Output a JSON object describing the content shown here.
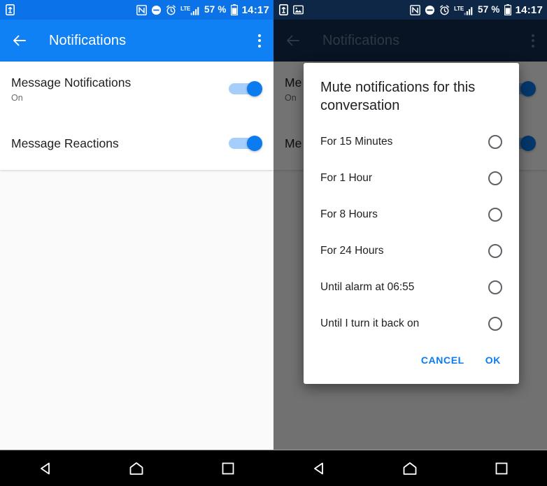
{
  "screens": {
    "left": {
      "statusbar": {
        "left_icons": [
          "sd-card-transfer-icon"
        ],
        "nfc_icon": "nfc-icon",
        "dnd_icon": "do-not-disturb-icon",
        "alarm_icon": "alarm-icon",
        "network_label": "LTE",
        "signal_icon": "signal-bars-icon",
        "battery_percent": "57 %",
        "battery_icon": "battery-icon",
        "time": "14:17"
      },
      "appbar": {
        "back_icon": "back-arrow-icon",
        "title": "Notifications",
        "overflow_icon": "overflow-menu-icon"
      },
      "settings": [
        {
          "title": "Message Notifications",
          "subtitle": "On",
          "switch_state": "on"
        },
        {
          "title": "Message Reactions",
          "subtitle": "",
          "switch_state": "on"
        }
      ]
    },
    "right": {
      "statusbar": {
        "left_icons": [
          "sd-card-transfer-icon",
          "image-icon"
        ],
        "nfc_icon": "nfc-icon",
        "dnd_icon": "do-not-disturb-icon",
        "alarm_icon": "alarm-icon",
        "network_label": "LTE",
        "signal_icon": "signal-bars-icon",
        "battery_percent": "57 %",
        "battery_icon": "battery-icon",
        "time": "14:17"
      },
      "appbar": {
        "back_icon": "back-arrow-icon",
        "title": "Notifications",
        "overflow_icon": "overflow-menu-icon"
      },
      "settings": [
        {
          "title": "Me",
          "subtitle": "On",
          "switch_state": "on"
        },
        {
          "title": "Me",
          "subtitle": "",
          "switch_state": "on"
        }
      ],
      "dialog": {
        "title": "Mute notifications for this conversation",
        "options": [
          {
            "label": "For 15 Minutes",
            "selected": false
          },
          {
            "label": "For 1 Hour",
            "selected": false
          },
          {
            "label": "For 8 Hours",
            "selected": false
          },
          {
            "label": "For 24 Hours",
            "selected": false
          },
          {
            "label": "Until alarm at 06:55",
            "selected": false
          },
          {
            "label": "Until I turn it back on",
            "selected": false
          }
        ],
        "cancel_label": "CANCEL",
        "ok_label": "OK"
      }
    }
  },
  "navbar": {
    "back_icon": "nav-back-triangle-icon",
    "home_icon": "nav-home-icon",
    "recents_icon": "nav-recents-square-icon"
  },
  "colors": {
    "accent_blue": "#0B7BF0",
    "appbar_blue": "#1080F5",
    "statusbar_blue": "#0B72E7",
    "switch_track": "#A6CEFB",
    "dialog_action_blue": "#0B7BF0"
  }
}
